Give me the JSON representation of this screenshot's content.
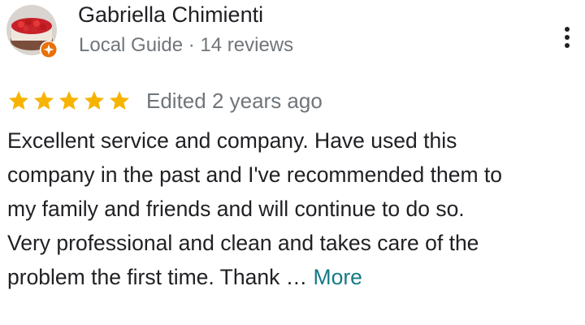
{
  "reviewer": {
    "name": "Gabriella Chimienti",
    "subtitle": "Local Guide · 14 reviews",
    "avatar_icon": "cake-photo-avatar",
    "badge_icon": "local-guide-star-badge"
  },
  "menu_icon": "more-vert-icon",
  "rating": {
    "stars": 5,
    "max_stars": 5,
    "star_color": "#f6b400",
    "meta": "Edited 2 years ago"
  },
  "review": {
    "lines": [
      "Excellent service and company. Have used this",
      "company in the past and I've recommended them to",
      "my family and friends and will continue to do so.",
      "Very professional and clean and takes care of the",
      "problem the first time. Thank … "
    ],
    "more_label": "More",
    "more_color": "#137a85"
  }
}
